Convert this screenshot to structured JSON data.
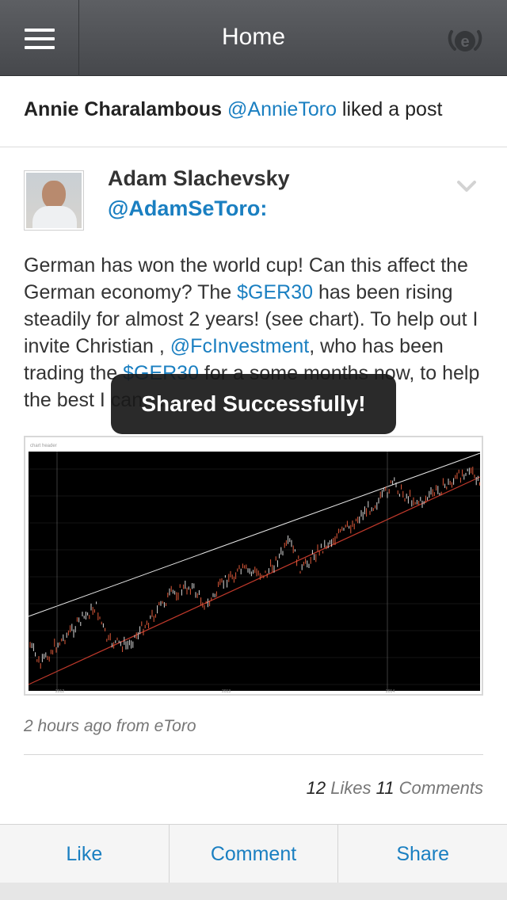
{
  "header": {
    "title": "Home",
    "menu_icon": "hamburger-menu-icon",
    "logo_icon": "etoro-logo-icon"
  },
  "activity": {
    "user": "Annie Charalambous",
    "handle": "@AnnieToro",
    "action": "liked a post"
  },
  "post": {
    "author": "Adam Slachevsky",
    "handle": "@AdamSeToro:",
    "text_parts": {
      "p1": "German has won the world cup! Can this affect the German economy? The ",
      "link1": "$GER30",
      "p2": " has been rising steadily for almost 2 years! (see chart). To help out I invite Christian , ",
      "link2": "@FcInvestment",
      "p3": ", who has been trading the ",
      "link3": "$GER30",
      "p4": " for a some months now, to help the best I can.. ..."
    },
    "timestamp": "2 hours ago from eToro",
    "likes_count": "12",
    "likes_label": "Likes",
    "comments_count": "11",
    "comments_label": "Comments"
  },
  "toast": {
    "message": "Shared Successfully!"
  },
  "actions": {
    "like": "Like",
    "comment": "Comment",
    "share": "Share"
  },
  "colors": {
    "link": "#1a7fc1",
    "header": "#4f5155",
    "chart_bg": "#000000",
    "support_line": "#c0392b",
    "resistance_line": "#e8e8e8"
  }
}
